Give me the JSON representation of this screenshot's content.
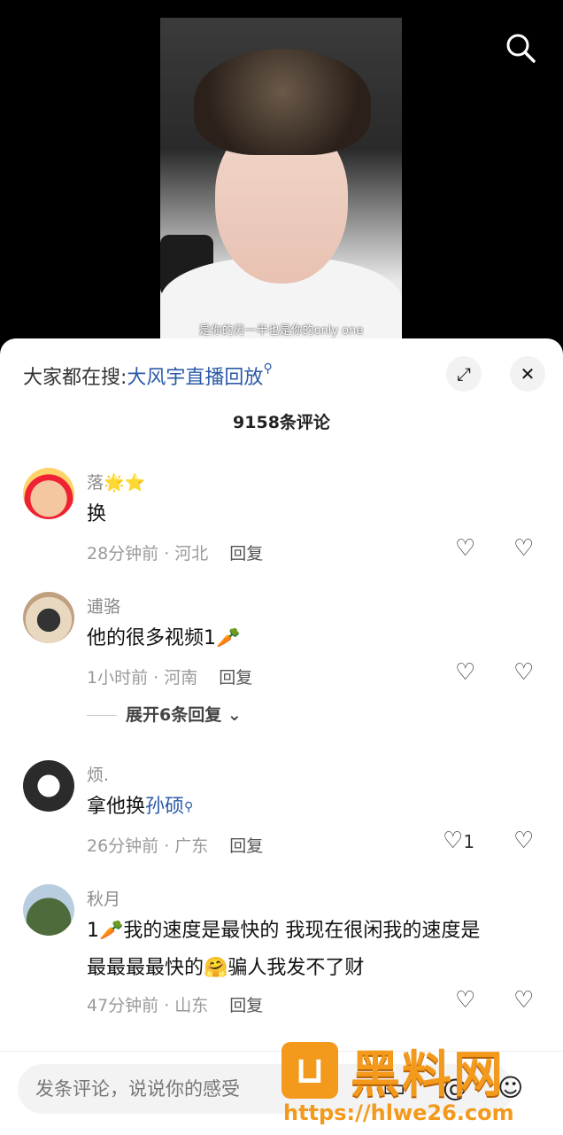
{
  "video": {
    "subtitle": "是你的另一半也是你的only one"
  },
  "header": {
    "hot_search_prefix": "大家都在搜:",
    "hot_search_keyword": "大风宇直播回放",
    "expand_icon": "expand-icon",
    "close_icon": "close-icon"
  },
  "comments_count": "9158条评论",
  "comments": [
    {
      "user": "落🌟⭐",
      "text": "换",
      "time": "28分钟前 · 河北",
      "reply": "回复",
      "likes": ""
    },
    {
      "user": "逋骆",
      "text": "他的很多视频1🥕",
      "time": "1小时前 · 河南",
      "reply": "回复",
      "likes": "",
      "expand": "展开6条回复"
    },
    {
      "user": "烦.",
      "text_prefix": "拿他换",
      "text_link": "孙硕",
      "time": "26分钟前 · 广东",
      "reply": "回复",
      "likes": "1"
    },
    {
      "user": "秋月",
      "text_line1": "1🥕我的速度是最快的 我现在很闲我的速度是",
      "text_line2": "最最最最快的🤗骗人我发不了财",
      "time": "47分钟前 · 山东",
      "reply": "回复",
      "likes": ""
    }
  ],
  "composer": {
    "placeholder": "发条评论，说说你的感受"
  },
  "watermark": {
    "text": "黑料网",
    "url": "https://hlwe26.com"
  }
}
